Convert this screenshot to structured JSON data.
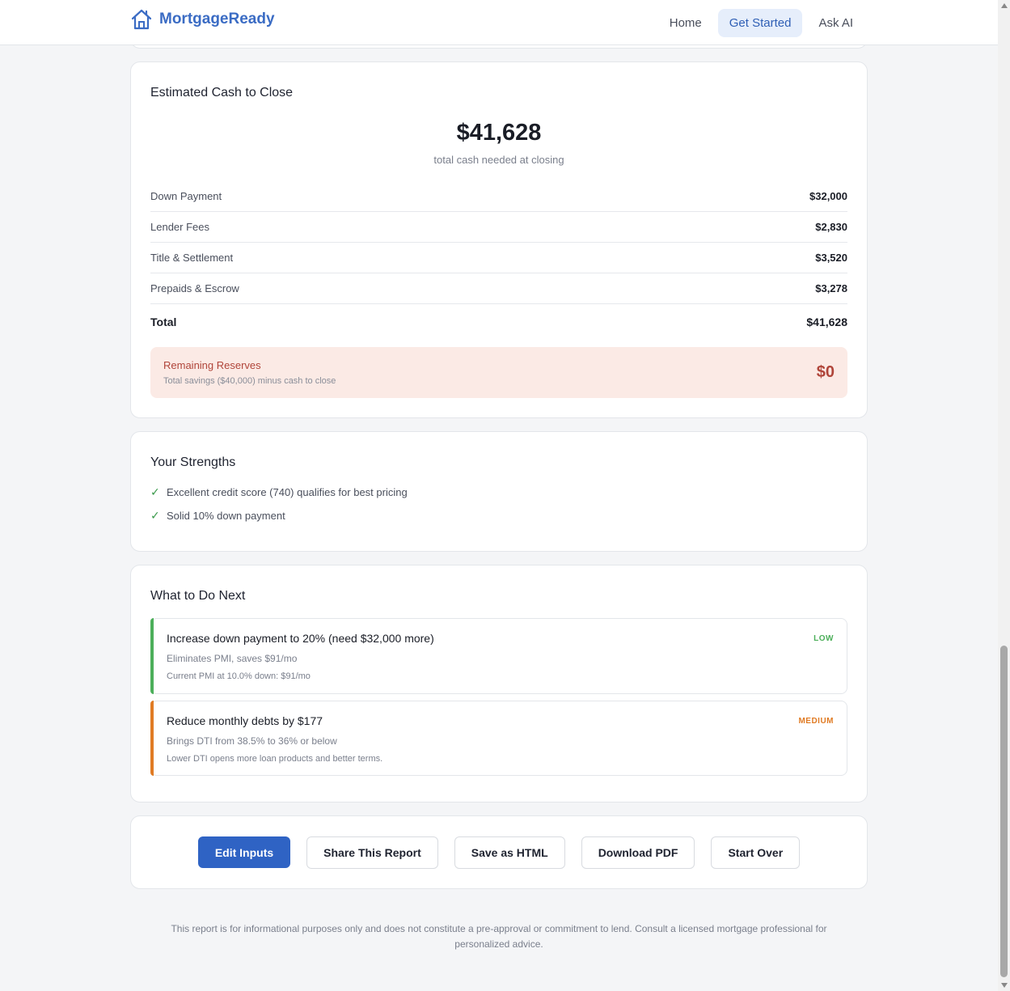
{
  "header": {
    "brand": "MortgageReady",
    "nav": [
      {
        "label": "Home"
      },
      {
        "label": "Get Started"
      },
      {
        "label": "Ask AI"
      }
    ]
  },
  "cash_to_close": {
    "title": "Estimated Cash to Close",
    "amount": "$41,628",
    "subtitle": "total cash needed at closing",
    "rows": [
      {
        "label": "Down Payment",
        "value": "$32,000"
      },
      {
        "label": "Lender Fees",
        "value": "$2,830"
      },
      {
        "label": "Title & Settlement",
        "value": "$3,520"
      },
      {
        "label": "Prepaids & Escrow",
        "value": "$3,278"
      }
    ],
    "total": {
      "label": "Total",
      "value": "$41,628"
    },
    "reserves": {
      "title": "Remaining Reserves",
      "subtitle": "Total savings ($40,000) minus cash to close",
      "value": "$0"
    }
  },
  "strengths": {
    "title": "Your Strengths",
    "items": [
      "Excellent credit score (740) qualifies for best pricing",
      "Solid 10% down payment"
    ]
  },
  "next_steps": {
    "title": "What to Do Next",
    "items": [
      {
        "title": "Increase down payment to 20% (need $32,000 more)",
        "desc": "Eliminates PMI, saves $91/mo",
        "note": "Current PMI at 10.0% down: $91/mo",
        "priority": "LOW",
        "color": "#4caf5a"
      },
      {
        "title": "Reduce monthly debts by $177",
        "desc": "Brings DTI from 38.5% to 36% or below",
        "note": "Lower DTI opens more loan products and better terms.",
        "priority": "MEDIUM",
        "color": "#e07b24"
      }
    ]
  },
  "actions": {
    "edit": "Edit Inputs",
    "share": "Share This Report",
    "save_html": "Save as HTML",
    "download_pdf": "Download PDF",
    "start_over": "Start Over"
  },
  "footer": {
    "disclaimer": "This report is for informational purposes only and does not constitute a pre-approval or commitment to lend. Consult a licensed mortgage professional for personalized advice."
  },
  "colors": {
    "accent": "#2f63c4",
    "danger": "#b0453a",
    "success": "#3a9a4b"
  }
}
